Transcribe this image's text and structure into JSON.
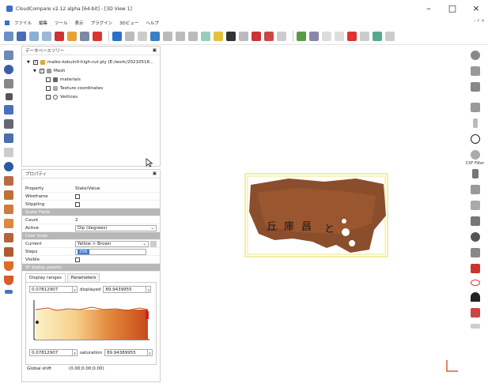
{
  "window": {
    "title": "CloudCompare v2.12 alpha [64-bit] - [3D View 1]",
    "controls": {
      "minimize": "–",
      "maximize": "□",
      "close": "×"
    }
  },
  "menu": {
    "items": [
      "ファイル",
      "編集",
      "ツール",
      "表示",
      "プラグイン",
      "3Dビュー",
      "ヘルプ"
    ],
    "right": "- ♯ ×"
  },
  "colors": {
    "accent": "#3a7be0",
    "section_bg": "#b7b7b7",
    "bbox": "#e5dd4a",
    "mesh": "#8a4e2c"
  },
  "db_tree": {
    "title": "データベースツリー",
    "items": [
      {
        "label": "maiko-kokuin0-high-cut.ply (E:/work/20210518...",
        "level": 0,
        "checked": true
      },
      {
        "label": "Mesh",
        "level": 1,
        "checked": true
      },
      {
        "label": "materials",
        "level": 2,
        "checked": false
      },
      {
        "label": "Texture coordinates",
        "level": 2,
        "checked": false
      },
      {
        "label": "Vertices",
        "level": 2,
        "checked": false
      }
    ]
  },
  "properties": {
    "title": "プロパティ",
    "header": {
      "k": "Property",
      "v": "State/Value"
    },
    "rows_a": [
      {
        "k": "Wireframe",
        "type": "check",
        "checked": false
      },
      {
        "k": "Stippling",
        "type": "check",
        "checked": false
      }
    ],
    "section_scalar": "Scalar Fields",
    "count_label": "Count",
    "count_value": "2",
    "active_label": "Active",
    "active_value": "Dip (degrees)",
    "section_color": "Color Scale",
    "current_label": "Current",
    "current_value": "Yellow > Brown",
    "steps_label": "Steps",
    "steps_value": "256",
    "visible_label": "Visible",
    "section_sf": "SF display params",
    "tabs": [
      "Display ranges",
      "Parameters"
    ],
    "min_value": "0.07812907",
    "displayed_label": "displayed",
    "displayed_value": "89.9439955",
    "max_value": "0.07812907",
    "saturation_label": "saturation",
    "saturation_value": "89.94389955",
    "global_shift_label": "Global shift",
    "global_shift_value": "(0.00;0.00;0.00)"
  },
  "righttb": {
    "label": "CSF Filter"
  }
}
